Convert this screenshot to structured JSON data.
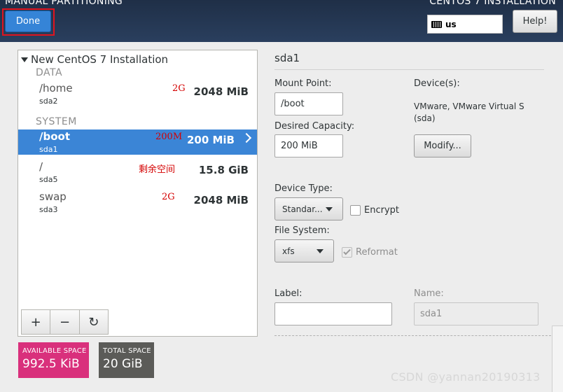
{
  "header": {
    "title": "MANUAL PARTITIONING",
    "right_title": "CENTOS 7 INSTALLATION",
    "done_label": "Done",
    "keyboard_layout": "us",
    "help_label": "Help!"
  },
  "tree": {
    "title": "New CentOS 7 Installation",
    "groups": [
      {
        "label": "DATA"
      },
      {
        "label": "SYSTEM"
      }
    ],
    "partitions": [
      {
        "mount": "/home",
        "device": "sda2",
        "size": "2048 MiB",
        "note": "2G"
      },
      {
        "mount": "/boot",
        "device": "sda1",
        "size": "200 MiB",
        "note": "200M",
        "selected": true
      },
      {
        "mount": "/",
        "device": "sda5",
        "size": "15.8 GiB",
        "note": "剩余空间"
      },
      {
        "mount": "swap",
        "device": "sda3",
        "size": "2048 MiB",
        "note": "2G"
      }
    ]
  },
  "toolbar": {
    "add_symbol": "+",
    "remove_symbol": "−",
    "refresh_symbol": "↻"
  },
  "space": {
    "available_label": "AVAILABLE SPACE",
    "available_value": "992.5 KiB",
    "total_label": "TOTAL SPACE",
    "total_value": "20 GiB",
    "available_color": "#d9307c",
    "total_color": "#5b5b58"
  },
  "details": {
    "title": "sda1",
    "mount_point_label": "Mount Point:",
    "mount_point_value": "/boot",
    "desired_capacity_label": "Desired Capacity:",
    "desired_capacity_value": "200 MiB",
    "devices_label": "Device(s):",
    "devices_text": "VMware, VMware Virtual S (sda)",
    "modify_label": "Modify...",
    "device_type_label": "Device Type:",
    "device_type_value": "Standar...",
    "encrypt_label": "Encrypt",
    "encrypt_checked": false,
    "file_system_label": "File System:",
    "file_system_value": "xfs",
    "reformat_label": "Reformat",
    "reformat_checked": true,
    "label_label": "Label:",
    "label_value": "",
    "name_label": "Name:",
    "name_value": "sda1"
  },
  "watermark": "CSDN @yannan20190313",
  "colors": {
    "accent": "#3584d7",
    "selected_row": "#3b85d6",
    "annotation_red": "#d40000",
    "highlight_outline": "#e1141f"
  }
}
